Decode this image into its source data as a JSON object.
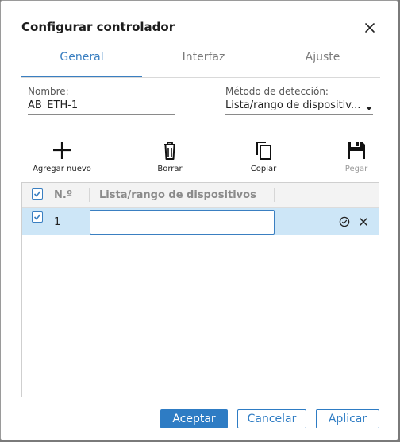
{
  "dialog": {
    "title": "Configurar controlador",
    "close_icon": "close-icon"
  },
  "tabs": [
    {
      "label": "General",
      "active": true
    },
    {
      "label": "Interfaz",
      "active": false
    },
    {
      "label": "Ajuste",
      "active": false
    }
  ],
  "form": {
    "name_label": "Nombre:",
    "name_value": "AB_ETH-1",
    "method_label": "Método de detección:",
    "method_value": "Lista/rango de dispositiv..."
  },
  "toolbar": {
    "add_label": "Agregar nuevo",
    "delete_label": "Borrar",
    "copy_label": "Copiar",
    "paste_label": "Pegar",
    "paste_disabled": true
  },
  "table": {
    "headers": [
      "N.º",
      "Lista/rango de dispositivos"
    ],
    "rows": [
      {
        "number": "1",
        "value": "",
        "checked": true,
        "selected": true
      }
    ]
  },
  "footer": {
    "accept_label": "Aceptar",
    "cancel_label": "Cancelar",
    "apply_label": "Aplicar"
  },
  "colors": {
    "accent": "#2e7cc4",
    "selected_row": "#cde6f7",
    "disabled_text": "#9a9a9a"
  }
}
